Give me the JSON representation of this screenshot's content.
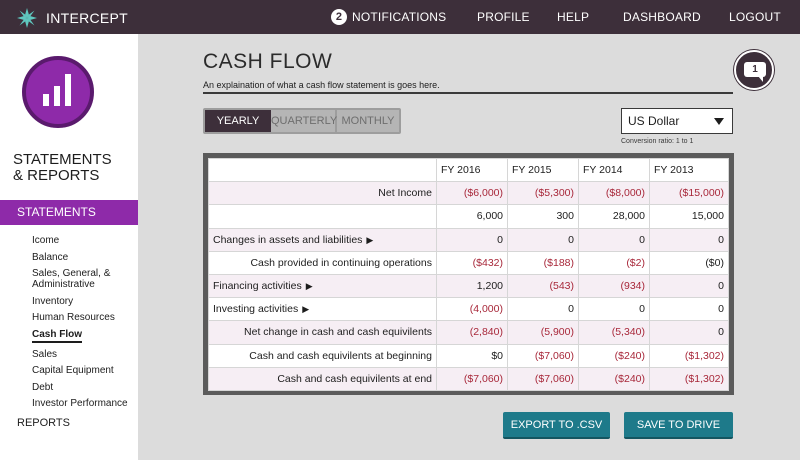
{
  "header": {
    "brand": "INTERCEPT",
    "notifications_count": "2",
    "notifications_label": "NOTIFICATIONS",
    "nav": [
      "PROFILE",
      "HELP",
      "DASHBOARD",
      "LOGOUT"
    ]
  },
  "sidebar": {
    "title": "STATEMENTS\n& REPORTS",
    "active_section": "STATEMENTS",
    "items": [
      "Icome",
      "Balance",
      "Sales, General, & Administrative",
      "Inventory",
      "Human Resources",
      "Cash Flow",
      "Sales",
      "Capital Equipment",
      "Debt",
      "Investor Performance"
    ],
    "current_item": "Cash Flow",
    "reports": "REPORTS"
  },
  "main": {
    "title": "CASH FLOW",
    "description": "An explaination of what a cash flow statement is goes here.",
    "help_badge": "1",
    "period_tabs": [
      "YEARLY",
      "QUARTERLY",
      "MONTHLY"
    ],
    "active_period": "YEARLY",
    "currency": "US Dollar",
    "conversion": "Conversion ratio: 1 to 1",
    "columns": [
      "FY 2016",
      "FY 2015",
      "FY 2014",
      "FY 2013"
    ],
    "rows": [
      {
        "label": "Net Income",
        "align": "right",
        "values": [
          "($6,000)",
          "($5,300)",
          "($8,000)",
          "($15,000)"
        ],
        "negative": [
          true,
          true,
          true,
          true
        ]
      },
      {
        "label": "",
        "align": "right",
        "values": [
          "6,000",
          "300",
          "28,000",
          "15,000"
        ],
        "negative": [
          false,
          false,
          false,
          false
        ]
      },
      {
        "label": "Changes in assets and liabilities",
        "align": "left",
        "expand": "▶",
        "values": [
          "0",
          "0",
          "0",
          "0"
        ],
        "negative": [
          false,
          false,
          false,
          false
        ]
      },
      {
        "label": "Cash provided in continuing operations",
        "align": "right",
        "values": [
          "($432)",
          "($188)",
          "($2)",
          "($0)"
        ],
        "negative": [
          true,
          true,
          true,
          false
        ]
      },
      {
        "label": "Financing activities",
        "align": "left",
        "expand": "▶",
        "values": [
          "1,200",
          "(543)",
          "(934)",
          "0"
        ],
        "negative": [
          false,
          true,
          true,
          false
        ]
      },
      {
        "label": "Investing activities",
        "align": "left",
        "expand": "▶",
        "values": [
          "(4,000)",
          "0",
          "0",
          "0"
        ],
        "negative": [
          true,
          false,
          false,
          false
        ]
      },
      {
        "label": "Net change in cash and cash equivilents",
        "align": "right",
        "values": [
          "(2,840)",
          "(5,900)",
          "(5,340)",
          "0"
        ],
        "negative": [
          true,
          true,
          true,
          false
        ]
      },
      {
        "label": "Cash and cash equivilents at beginning",
        "align": "right",
        "values": [
          "$0",
          "($7,060)",
          "($240)",
          "($1,302)"
        ],
        "negative": [
          false,
          true,
          true,
          true
        ]
      },
      {
        "label": "Cash and cash equivilents at end",
        "align": "right",
        "values": [
          "($7,060)",
          "($7,060)",
          "($240)",
          "($1,302)"
        ],
        "negative": [
          true,
          true,
          true,
          true
        ]
      }
    ],
    "buttons": {
      "export": "EXPORT TO .CSV",
      "save": "SAVE TO DRIVE"
    }
  },
  "colors": {
    "topbar": "#3d2f3a",
    "accent": "#8e2aa9",
    "button": "#1e7a8a",
    "negative": "#a8283a"
  }
}
